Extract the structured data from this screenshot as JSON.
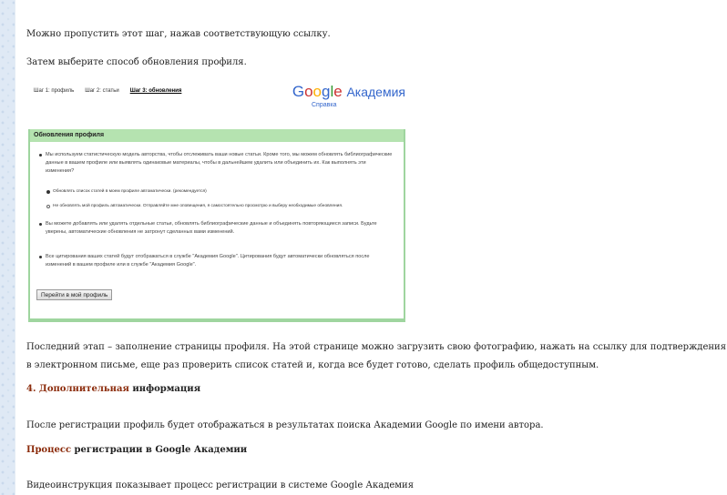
{
  "content": {
    "p1": "Можно пропустить этот шаг, нажав соответствующую ссылку.",
    "p2": "Затем выберите способ обновления профиля.",
    "p3": "Последний этап – заполнение страницы профиля. На этой странице можно загрузить свою фотографию, нажать на ссылку для подтверждения в электронном письме, еще раз проверить список статей и, когда все будет готово, сделать профиль общедоступным.",
    "heading1_accent": "4. Дополнительная",
    "heading1_rest": "информация",
    "p4": "После регистрации профиль будет отображаться в результатах поиска Академии Google по имени автора.",
    "heading2_accent": "Процесс",
    "heading2_rest": "регистрации в Google Академии",
    "p5": "Видеоинструкция показывает процесс регистрации в системе Google Академия"
  },
  "screenshot": {
    "steps": [
      "Шаг 1: профиль",
      "Шаг 2: статьи",
      "Шаг 3: обновления"
    ],
    "logo_google": "Google",
    "logo_suffix": "Академия",
    "help_link": "Справка",
    "panel_title": "Обновления профиля",
    "bullet1": "Мы используем статистическую модель авторства, чтобы отслеживать ваши новые статьи. Кроме того, мы можем обновлять библиографические данные в вашем профиле или выявлять одинаковые материалы, чтобы в дальнейшем удалить или объединить их. Как выполнять эти изменения?",
    "radio1": "Обновлять список статей в моем профиле автоматически. (рекомендуется)",
    "radio2": "Не обновлять мой профиль автоматически. Отправляйте мне оповещения, я самостоятельно просмотрю и выберу необходимые обновления.",
    "bullet2": "Вы можете добавлять или удалять отдельные статьи, обновлять библиографические данные и объединять повторяющиеся записи. Будьте уверены, автоматические обновления не затронут сделанных вами изменений.",
    "bullet3": "Все цитирования ваших статей будут отображаться в службе \"Академия Google\". Цитирования будут автоматически обновляться после изменений в вашем профиле или в службе \"Академия Google\".",
    "button": "Перейти в мой профиль"
  },
  "colors": {
    "accent": "#8b2b0b",
    "panel_header": "#b5e3b0",
    "link": "#3366cc"
  }
}
